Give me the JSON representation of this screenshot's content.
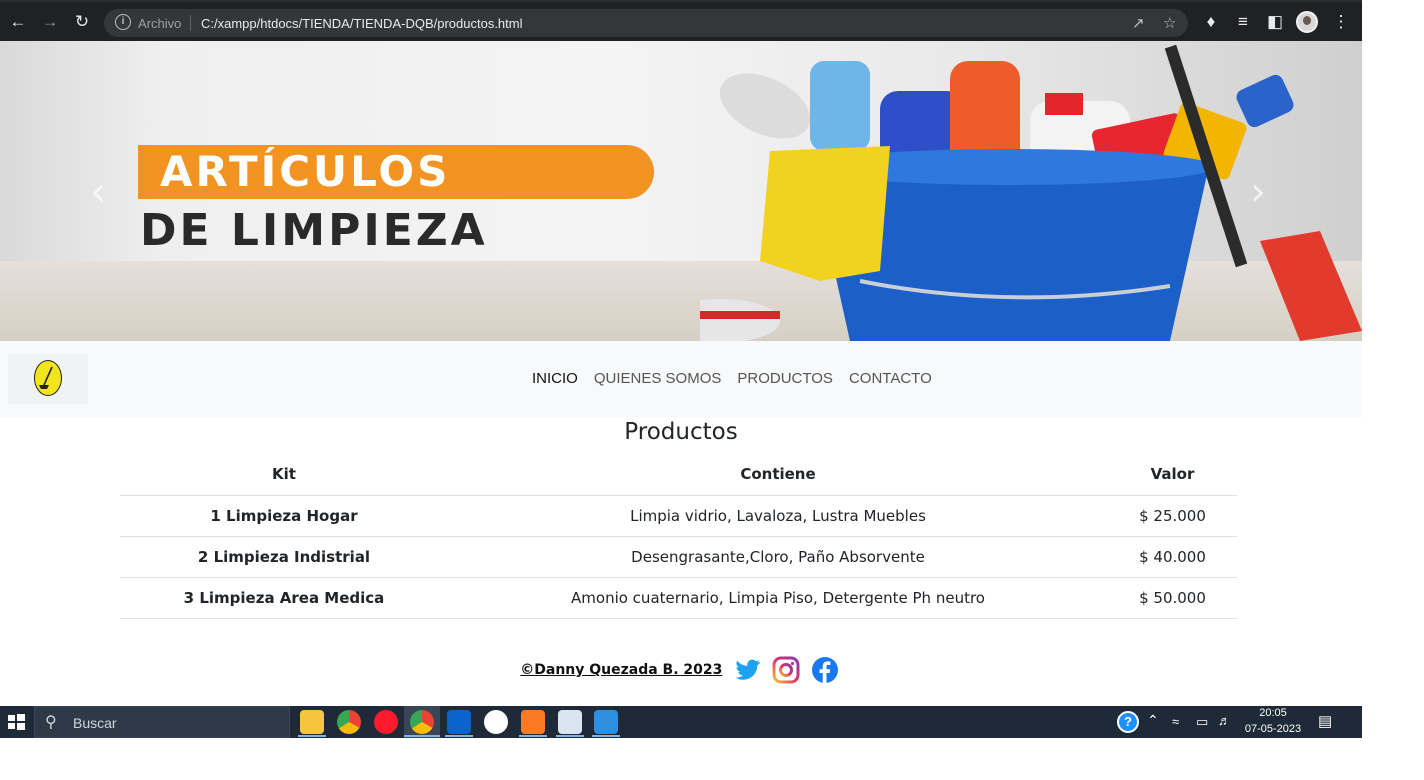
{
  "browser": {
    "security_label": "Archivo",
    "url": "C:/xampp/htdocs/TIENDA/TIENDA-DQB/productos.html",
    "back_icon": "arrow-left-icon",
    "forward_icon": "arrow-right-icon",
    "reload_icon": "reload-icon",
    "info_icon": "info-icon",
    "share_icon": "share-icon",
    "bookmark_icon": "star-icon",
    "extensions_icon": "puzzle-icon",
    "media_icon": "media-queue-icon",
    "sidepanel_icon": "side-panel-icon",
    "profile_icon": "avatar",
    "menu_icon": "kebab-menu-icon"
  },
  "hero": {
    "line1": "ARTÍCULOS",
    "line2": "DE LIMPIEZA",
    "prev_icon": "chevron-left-icon",
    "next_icon": "chevron-right-icon",
    "accent_color": "#f39321"
  },
  "navbar": {
    "logo_icon": "broom-logo-icon",
    "links": [
      {
        "label": "INICIO"
      },
      {
        "label": "QUIENES SOMOS"
      },
      {
        "label": "PRODUCTOS"
      },
      {
        "label": "CONTACTO"
      }
    ]
  },
  "main": {
    "title": "Productos",
    "table": {
      "headers": [
        "Kit",
        "Contiene",
        "Valor"
      ],
      "rows": [
        {
          "kit": "1 Limpieza Hogar",
          "contiene": "Limpia vidrio, Lavaloza, Lustra Muebles",
          "valor": "$ 25.000"
        },
        {
          "kit": "2 Limpieza Indistrial",
          "contiene": "Desengrasante,Cloro, Paño Absorvente",
          "valor": "$ 40.000"
        },
        {
          "kit": "3 Limpieza Area Medica",
          "contiene": "Amonio cuaternario, Limpia Piso, Detergente Ph neutro",
          "valor": "$ 50.000"
        }
      ]
    }
  },
  "footer": {
    "copyright": "©Danny Quezada B. 2023",
    "social": [
      "twitter-icon",
      "instagram-icon",
      "facebook-icon"
    ],
    "colors": {
      "twitter": "#1da1f2",
      "facebook": "#1877f2"
    }
  },
  "taskbar": {
    "search_placeholder": "Buscar",
    "apps": [
      "file-explorer-icon",
      "chrome-icon",
      "opera-icon",
      "chrome-active-icon",
      "outlook-icon",
      "github-icon",
      "xampp-icon",
      "paint-icon",
      "photos-icon"
    ],
    "time": "20:05",
    "date": "07-05-2023"
  }
}
